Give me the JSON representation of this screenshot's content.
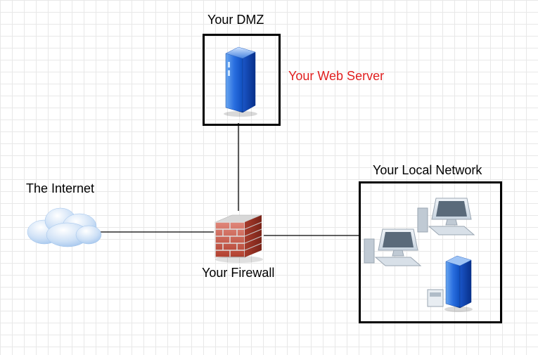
{
  "labels": {
    "dmz": "Your DMZ",
    "webserver": "Your Web Server",
    "internet": "The Internet",
    "firewall": "Your Firewall",
    "lan": "Your Local Network"
  },
  "nodes": {
    "internet": {
      "type": "cloud"
    },
    "dmz": {
      "type": "server",
      "boxed": true
    },
    "firewall": {
      "type": "firewall"
    },
    "lan": {
      "type": "local-network",
      "boxed": true,
      "contents": [
        "workstation",
        "workstation",
        "server"
      ]
    }
  },
  "connections": [
    [
      "internet",
      "firewall"
    ],
    [
      "dmz",
      "firewall"
    ],
    [
      "lan",
      "firewall"
    ]
  ]
}
